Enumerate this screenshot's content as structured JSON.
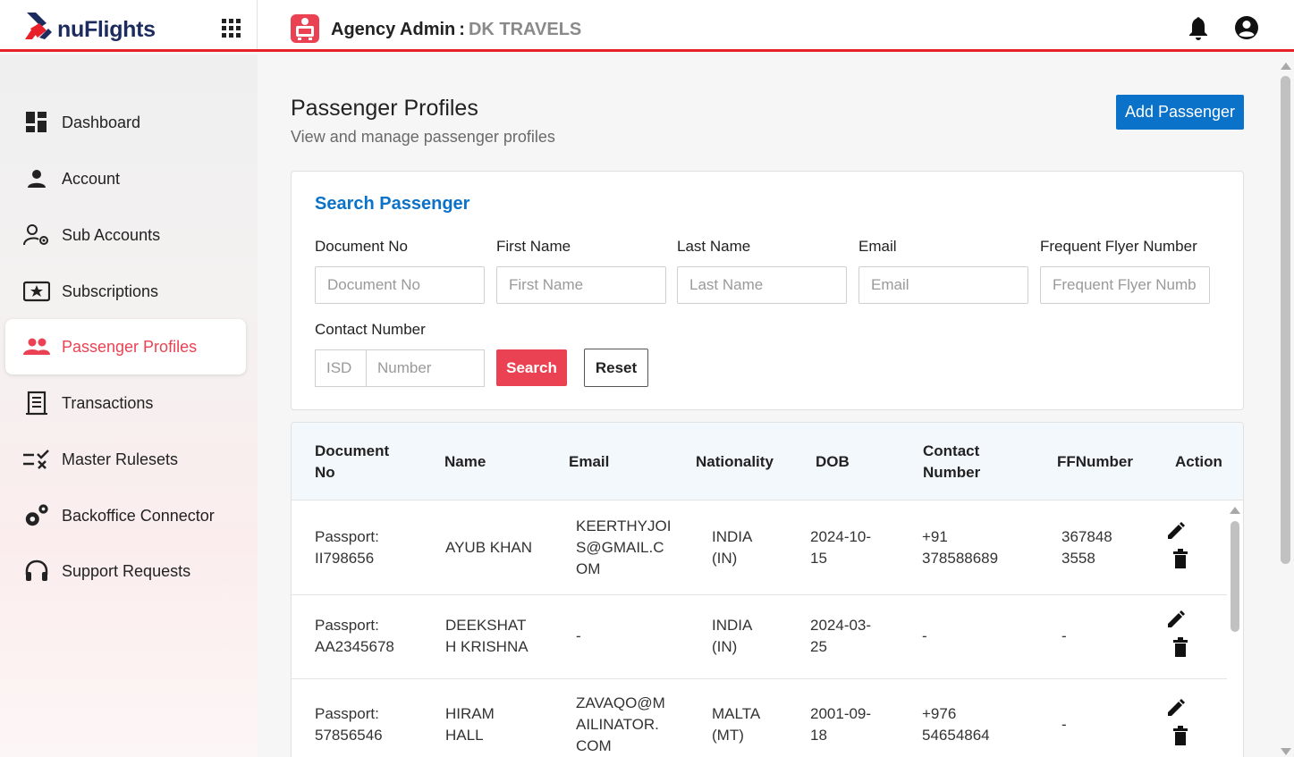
{
  "header": {
    "logo_text": "nuFlights",
    "agency_prefix": "Agency Admin",
    "agency_colon": ":",
    "agency_name": "DK TRAVELS"
  },
  "sidebar": {
    "items": [
      {
        "label": "Dashboard",
        "icon": "dashboard-icon"
      },
      {
        "label": "Account",
        "icon": "person-icon"
      },
      {
        "label": "Sub Accounts",
        "icon": "manage-accounts-icon"
      },
      {
        "label": "Subscriptions",
        "icon": "star-ticket-icon"
      },
      {
        "label": "Passenger Profiles",
        "icon": "people-icon",
        "active": true
      },
      {
        "label": "Transactions",
        "icon": "receipt-icon"
      },
      {
        "label": "Master Rulesets",
        "icon": "rule-icon"
      },
      {
        "label": "Backoffice Connector",
        "icon": "settings-gears-icon"
      },
      {
        "label": "Support Requests",
        "icon": "headset-icon"
      }
    ]
  },
  "main": {
    "title": "Passenger Profiles",
    "subtitle": "View and manage passenger profiles",
    "add_button": "Add Passenger"
  },
  "search": {
    "title": "Search Passenger",
    "fields": [
      {
        "label": "Document No",
        "placeholder": "Document No"
      },
      {
        "label": "First Name",
        "placeholder": "First Name"
      },
      {
        "label": "Last Name",
        "placeholder": "Last Name"
      },
      {
        "label": "Email",
        "placeholder": "Email"
      },
      {
        "label": "Frequent Flyer Number",
        "placeholder": "Frequent Flyer Numb"
      }
    ],
    "contact_label": "Contact Number",
    "isd_placeholder": "ISD",
    "number_placeholder": "Number",
    "search_button": "Search",
    "reset_button": "Reset"
  },
  "table": {
    "headers": {
      "doc_line1": "Document",
      "doc_line2": "No",
      "name": "Name",
      "email": "Email",
      "nationality": "Nationality",
      "dob": "DOB",
      "contact_line1": "Contact",
      "contact_line2": "Number",
      "ff": "FFNumber",
      "action": "Action"
    },
    "rows": [
      {
        "doc": [
          "Passport:",
          "II798656"
        ],
        "name": [
          "AYUB KHAN"
        ],
        "email": [
          "KEERTHYJOI",
          "S@GMAIL.C",
          "OM"
        ],
        "nationality": [
          "INDIA",
          "(IN)"
        ],
        "dob": [
          "2024-10-",
          "15"
        ],
        "contact": [
          "+91",
          "378588689"
        ],
        "ff": [
          "367848",
          "3558"
        ]
      },
      {
        "doc": [
          "Passport:",
          "AA2345678"
        ],
        "name": [
          "DEEKSHAT",
          "H KRISHNA"
        ],
        "email": [
          "-"
        ],
        "nationality": [
          "INDIA",
          "(IN)"
        ],
        "dob": [
          "2024-03-",
          "25"
        ],
        "contact": [
          "-"
        ],
        "ff": [
          "-"
        ]
      },
      {
        "doc": [
          "Passport:",
          "57856546"
        ],
        "name": [
          "HIRAM",
          "HALL"
        ],
        "email": [
          "ZAVAQO@M",
          "AILINATOR.",
          "COM"
        ],
        "nationality": [
          "MALTA",
          "(MT)"
        ],
        "dob": [
          "2001-09-",
          "18"
        ],
        "contact": [
          "+976",
          "54654864"
        ],
        "ff": [
          "-"
        ]
      }
    ]
  },
  "colors": {
    "brand_red": "#e8202a",
    "accent_blue": "#0b72c9",
    "search_red": "#ea4253",
    "logo_navy": "#1d2c5e"
  }
}
